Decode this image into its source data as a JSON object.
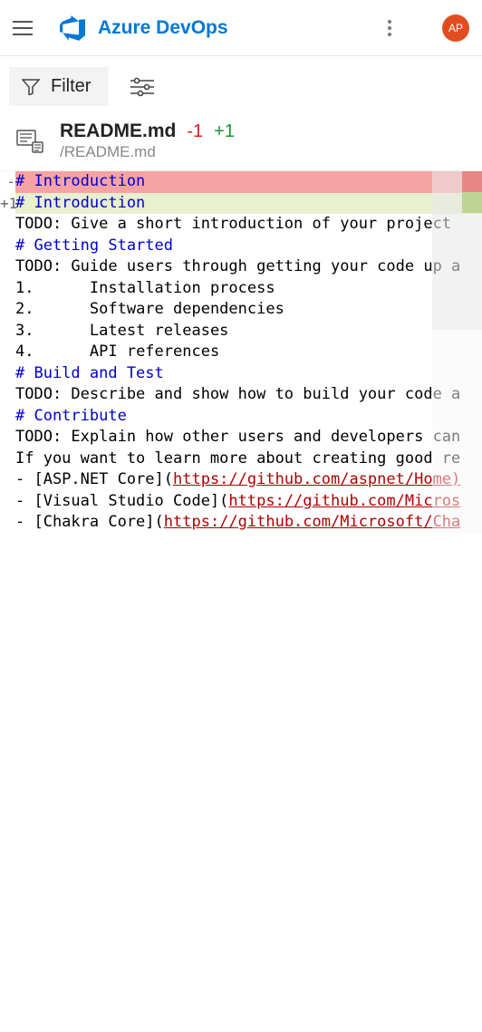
{
  "header": {
    "title": "Azure DevOps",
    "avatar": "AP"
  },
  "toolbar": {
    "filter": "Filter"
  },
  "file": {
    "name": "README.md",
    "minus": "-1",
    "plus": "+1",
    "path": "/README.md"
  },
  "diff": {
    "removed": {
      "marker": "-",
      "content": "# Introduction"
    },
    "added": {
      "marker": "+",
      "lineno": "1",
      "content": "# Introduction"
    },
    "context": [
      {
        "text": "TODO: Give a short introduction of your project"
      },
      {
        "text": ""
      },
      {
        "heading": "# Getting Started"
      },
      {
        "text": "TODO: Guide users through getting your code up a"
      },
      {
        "text": "1.\tInstallation process"
      },
      {
        "text": "2.\tSoftware dependencies"
      },
      {
        "text": "3.\tLatest releases"
      },
      {
        "text": "4.\tAPI references"
      },
      {
        "text": ""
      },
      {
        "heading": "# Build and Test"
      },
      {
        "text": "TODO: Describe and show how to build your code a"
      },
      {
        "text": ""
      },
      {
        "heading": "# Contribute"
      },
      {
        "text": "TODO: Explain how other users and developers can"
      },
      {
        "text": ""
      },
      {
        "text": "If you want to learn more about creating good re"
      },
      {
        "link_prefix": "- [ASP.NET Core](",
        "link_url": "https://github.com/aspnet/Home)"
      },
      {
        "link_prefix": "- [Visual Studio Code](",
        "link_url": "https://github.com/Micros"
      },
      {
        "link_prefix": "- [Chakra Core](",
        "link_url": "https://github.com/Microsoft/Cha"
      }
    ]
  }
}
